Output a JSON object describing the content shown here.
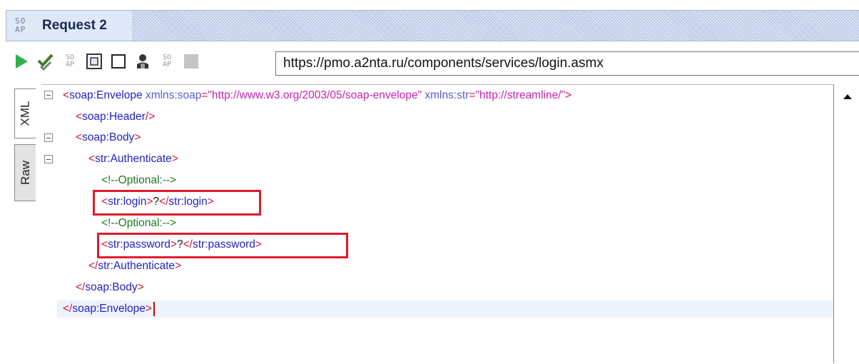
{
  "window": {
    "title": "Request 2",
    "logo_top": "SO",
    "logo_bottom": "AP"
  },
  "toolbar": {
    "buttons": [
      {
        "name": "run-request-button",
        "icon": "play-icon"
      },
      {
        "name": "check-request-button",
        "icon": "check-icon"
      },
      {
        "name": "soap-format-button",
        "icon": "soap-icon"
      },
      {
        "name": "fullscreen-button",
        "icon": "expand-icon"
      },
      {
        "name": "toggle-pane-button",
        "icon": "square-icon"
      },
      {
        "name": "auth-button",
        "icon": "user-icon"
      },
      {
        "name": "soap-settings-button",
        "icon": "soap-icon"
      },
      {
        "name": "stop-button",
        "icon": "stop-icon"
      }
    ],
    "endpoint_url": "https://pmo.a2nta.ru/components/services/login.asmx",
    "soap_icon_text_top": "SO",
    "soap_icon_text_bottom": "AP"
  },
  "side_tabs": {
    "xml": "XML",
    "raw": "Raw"
  },
  "editor": {
    "l1_lt": "<",
    "l1_tag": "soap:Envelope",
    "l1_a1": "xmlns:soap",
    "l1_eq1": "=",
    "l1_v1": "\"http://www.w3.org/2003/05/soap-envelope\"",
    "l1_a2": "xmlns:str",
    "l1_eq2": "=",
    "l1_v2": "\"http://streamline/\"",
    "l1_gt": ">",
    "l2_lt": "<",
    "l2_tag": "soap:Header",
    "l2_gt": "/>",
    "l3_lt": "<",
    "l3_tag": "soap:Body",
    "l3_gt": ">",
    "l4_lt": "<",
    "l4_tag": "str:Authenticate",
    "l4_gt": ">",
    "l5_comment": "<!--Optional:-->",
    "l6_lt": "<",
    "l6_tag": "str:login",
    "l6_gt": ">",
    "l6_val": "?",
    "l6_clt": "</",
    "l6_ctag": "str:login",
    "l6_cgt": ">",
    "l7_comment": "<!--Optional:-->",
    "l8_lt": "<",
    "l8_tag": "str:password",
    "l8_gt": ">",
    "l8_val": "?",
    "l8_clt": "</",
    "l8_ctag": "str:password",
    "l8_cgt": ">",
    "l9_lt": "</",
    "l9_tag": "str:Authenticate",
    "l9_gt": ">",
    "l10_lt": "</",
    "l10_tag": "soap:Body",
    "l10_gt": ">",
    "l11_lt": "</",
    "l11_tag": "soap:Envelope",
    "l11_gt": ">"
  },
  "colors": {
    "bracket": "#d0183b",
    "tag": "#2222c8",
    "attr_value": "#c821b4",
    "comment": "#1e7a1e",
    "highlight": "#e01a2b"
  }
}
